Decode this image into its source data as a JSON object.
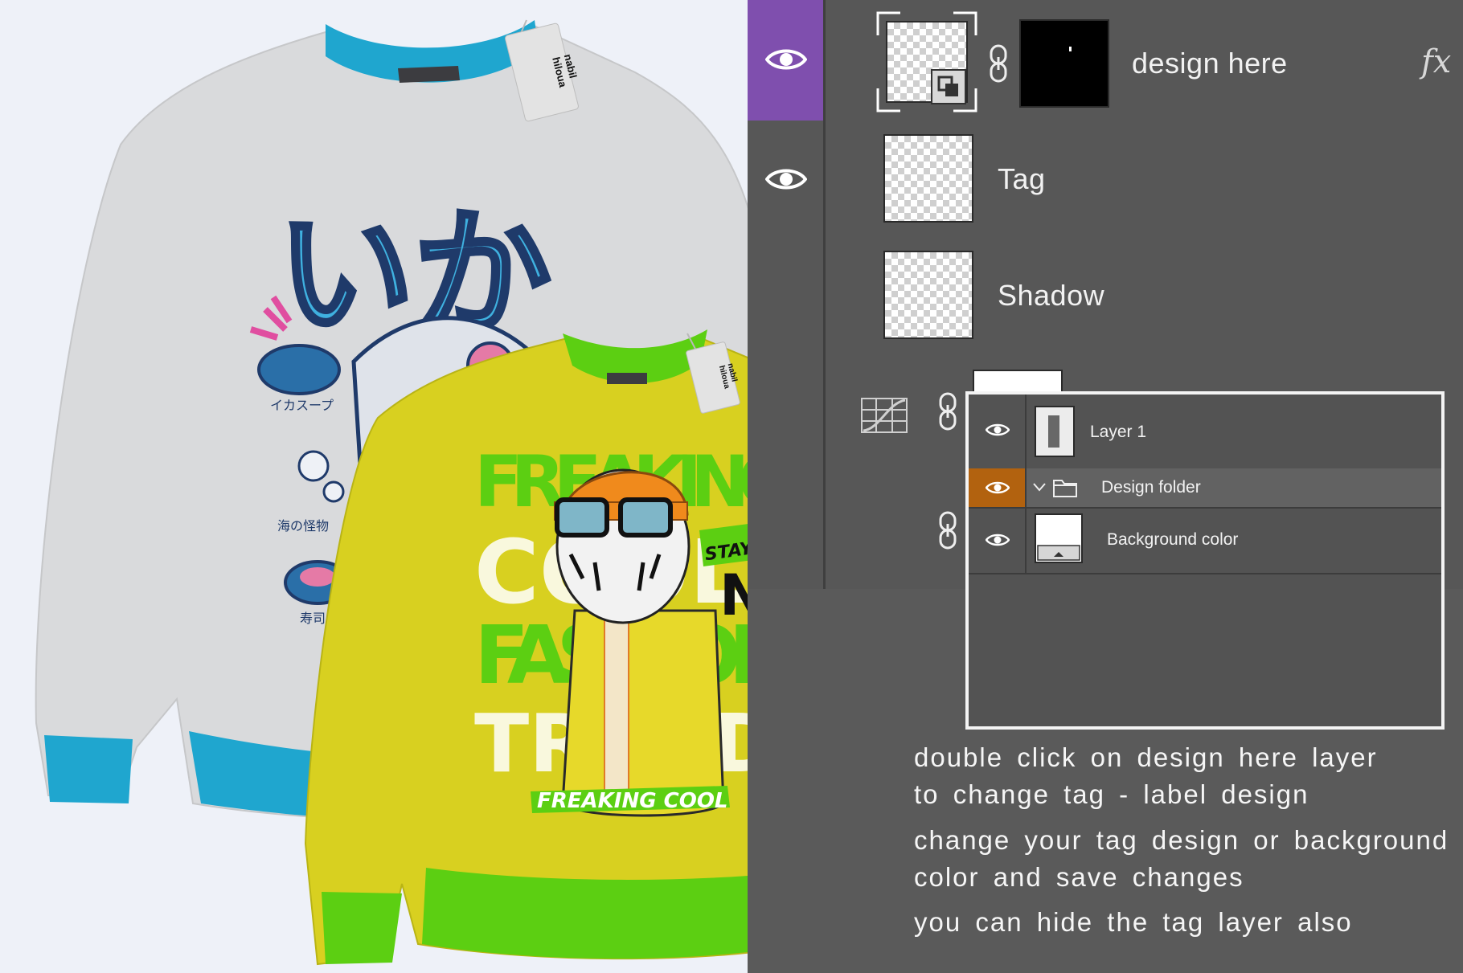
{
  "tag": {
    "brand_line1": "nabil",
    "brand_line2": "hiloua"
  },
  "back_sweatshirt": {
    "body_color": "#d9dadc",
    "rib_color": "#1fa6cf",
    "print": {
      "headline": "いか",
      "caption_soup": "イカスープ",
      "caption_monster": "海の怪物",
      "caption_sushi": "寿司"
    }
  },
  "front_sweatshirt": {
    "body_color": "#d8d020",
    "rib_color": "#5ccf12",
    "print": {
      "word1": "FREAKING",
      "word2": "COOL",
      "word3": "FASHION",
      "word4": "TREND",
      "badge": "STAY REAL",
      "ny": "NY",
      "banner": "FREAKING COOL"
    }
  },
  "layers_panel": {
    "accent_selected": "#7f4fae",
    "layers": [
      {
        "name": "design here",
        "fx": "fx",
        "selected": true
      },
      {
        "name": "Tag"
      },
      {
        "name": "Shadow"
      }
    ]
  },
  "inset_panel": {
    "accent_active": "#b2620f",
    "layers": [
      {
        "name": "Layer 1"
      },
      {
        "name": "Design folder"
      },
      {
        "name": "Background color"
      }
    ]
  },
  "instructions": {
    "line1": "double click on design here layer",
    "line2": "to change tag - label design",
    "line3": "change your tag design or background",
    "line4": "color and save changes",
    "line5": "you can hide the tag layer also"
  }
}
